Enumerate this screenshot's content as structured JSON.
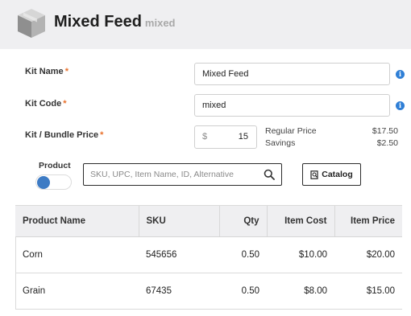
{
  "header": {
    "title": "Mixed Feed",
    "subtitle": "mixed",
    "icon": "box-icon"
  },
  "form": {
    "kit_name": {
      "label": "Kit Name",
      "required_mark": "*",
      "value": "Mixed Feed"
    },
    "kit_code": {
      "label": "Kit Code",
      "required_mark": "*",
      "value": "mixed"
    },
    "kit_price": {
      "label": "Kit / Bundle Price",
      "required_mark": "*",
      "currency": "$",
      "value": "15"
    },
    "info_glyph": "i"
  },
  "summary": {
    "regular_price_label": "Regular Price",
    "regular_price_value": "$17.50",
    "savings_label": "Savings",
    "savings_value": "$2.50"
  },
  "product_search": {
    "toggle_label": "Product",
    "placeholder": "SKU, UPC, Item Name, ID, Alternative",
    "catalog_label": "Catalog"
  },
  "table": {
    "headers": [
      "Product Name",
      "SKU",
      "Qty",
      "Item Cost",
      "Item Price"
    ],
    "rows": [
      {
        "name": "Corn",
        "sku": "545656",
        "qty": "0.50",
        "cost": "$10.00",
        "price": "$20.00"
      },
      {
        "name": "Grain",
        "sku": "67435",
        "qty": "0.50",
        "cost": "$8.00",
        "price": "$15.00"
      }
    ]
  },
  "colors": {
    "accent_blue": "#3d7bc4",
    "required_orange": "#e8702a",
    "header_bg": "#efeff1"
  }
}
